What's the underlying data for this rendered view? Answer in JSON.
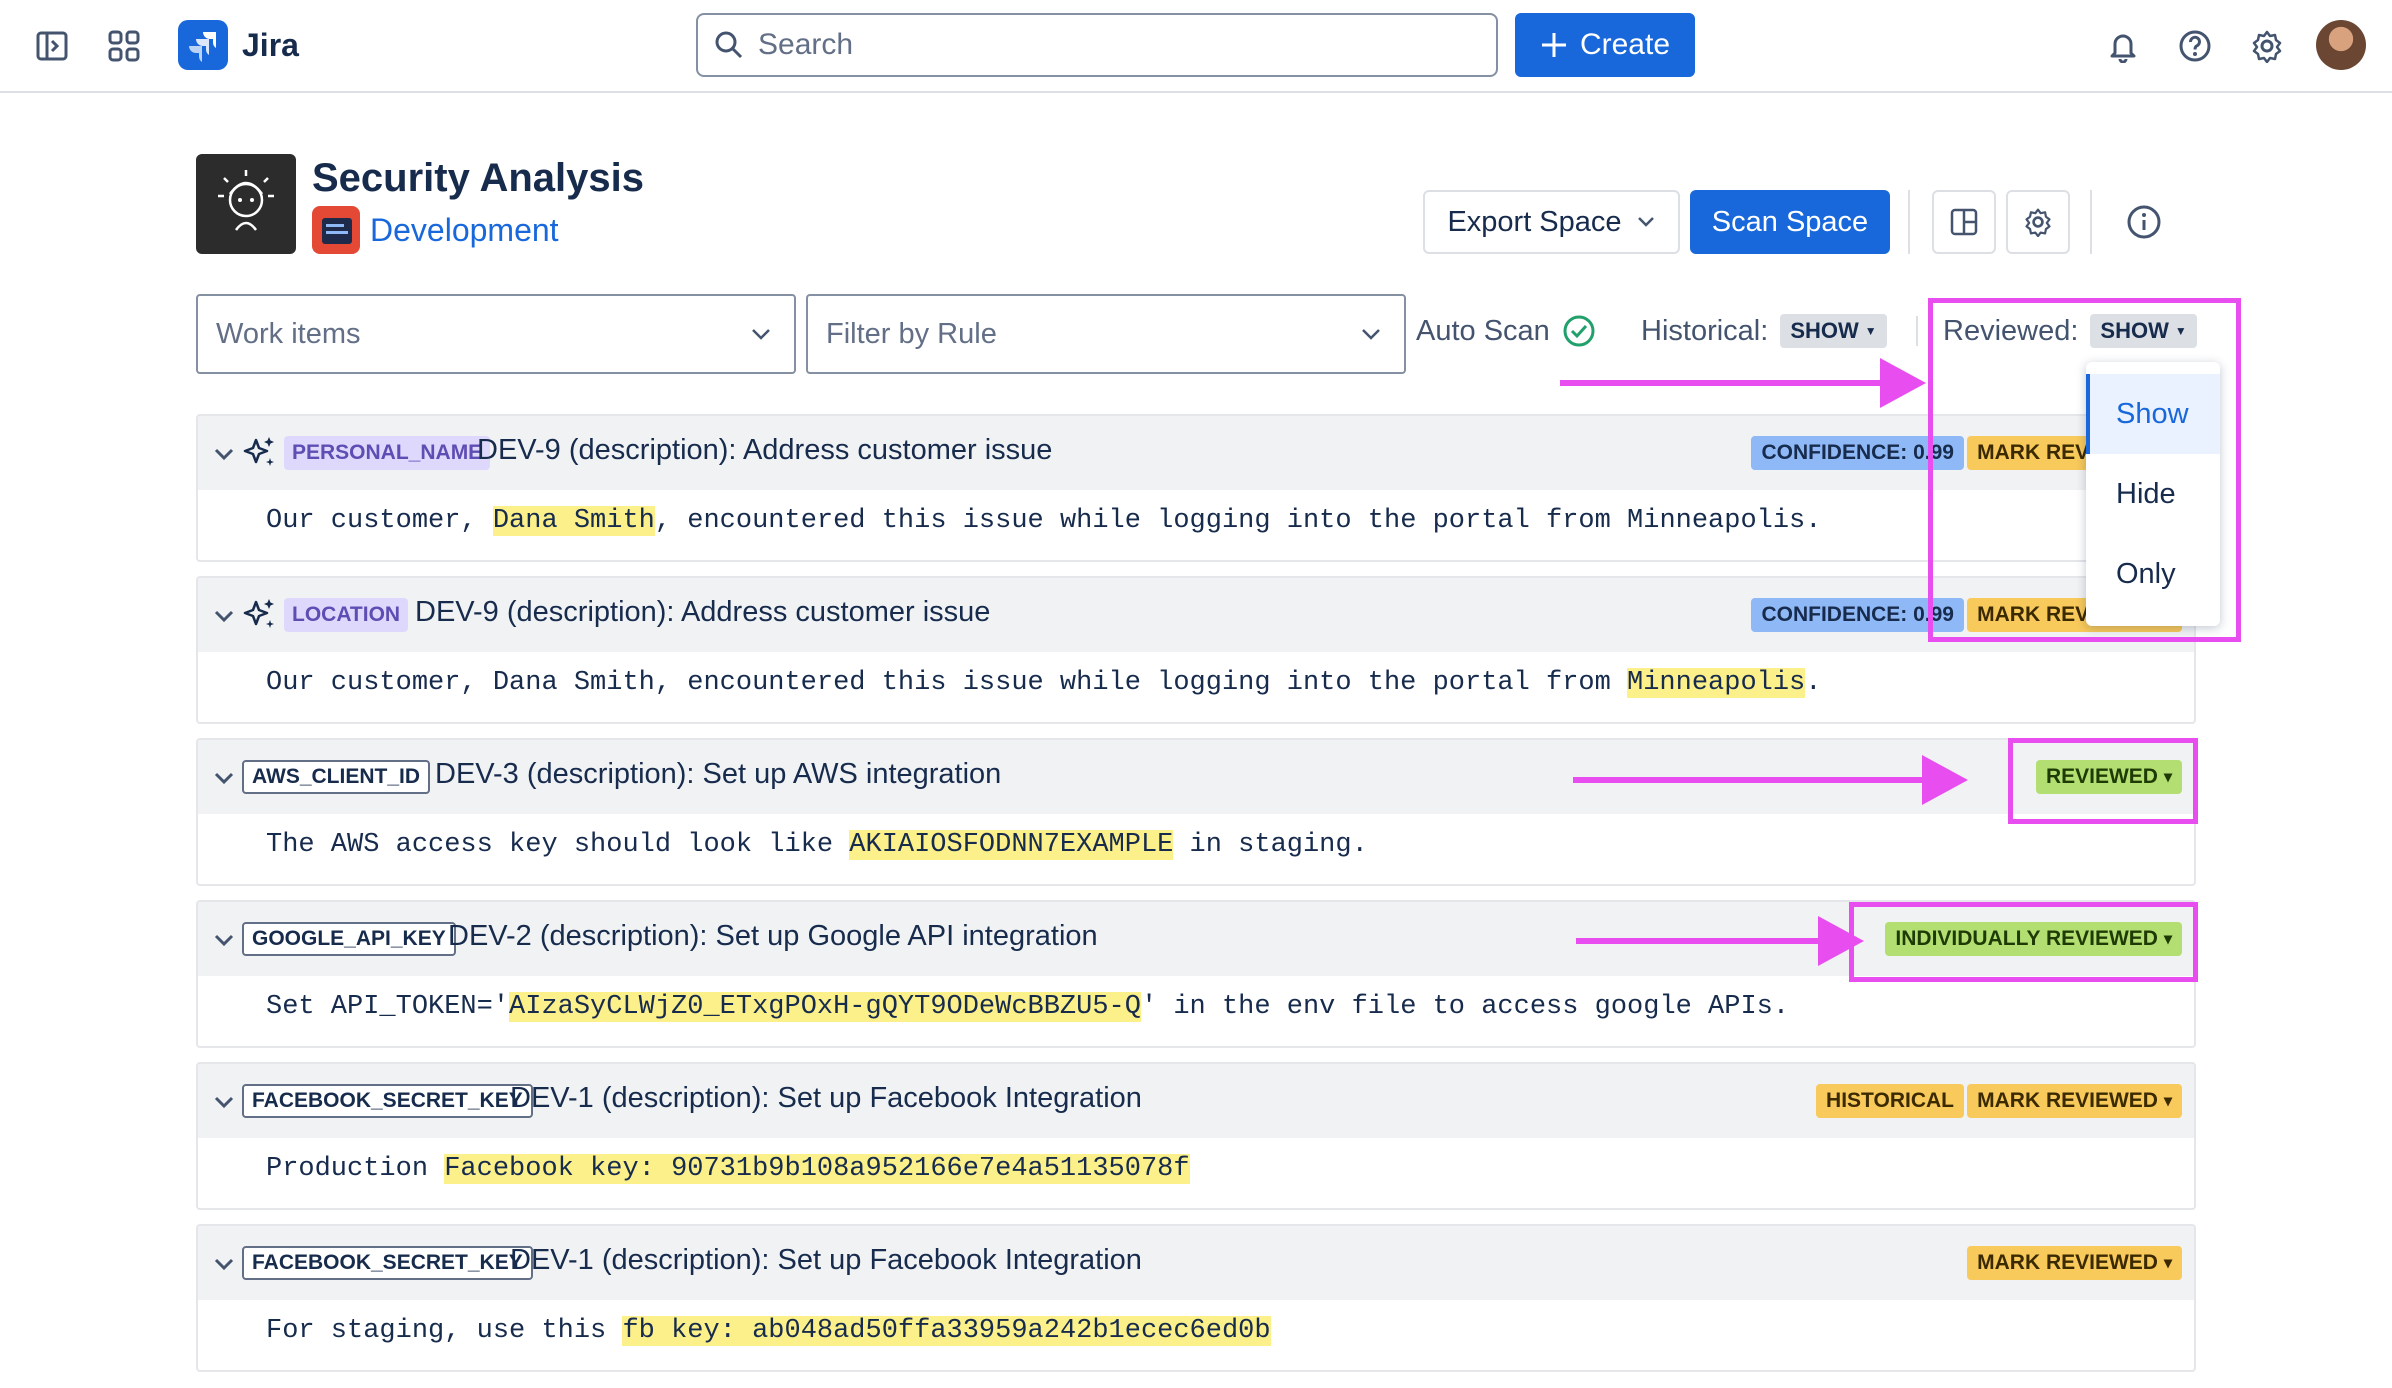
{
  "nav": {
    "app_name": "Jira",
    "search_placeholder": "Search",
    "create_label": "Create"
  },
  "space": {
    "title": "Security Analysis",
    "subtitle": "Development",
    "export_label": "Export Space",
    "scan_label": "Scan Space"
  },
  "filters": {
    "work_items_placeholder": "Work items",
    "rule_placeholder": "Filter by Rule",
    "auto_scan_label": "Auto Scan",
    "historical_label": "Historical:",
    "historical_value": "SHOW",
    "reviewed_label": "Reviewed:",
    "reviewed_value": "SHOW"
  },
  "reviewed_dropdown": {
    "options": [
      "Show",
      "Hide",
      "Only"
    ],
    "selected": "Show"
  },
  "findings": [
    {
      "rule": "PERSONAL_NAME",
      "ai": true,
      "title": "DEV-9 (description): Address customer issue",
      "badges": [
        "CONFIDENCE: 0.99",
        "MARK REVIEWED"
      ],
      "text_before": "Our customer, ",
      "highlight": "Dana Smith",
      "text_after": ", encountered this issue while logging into the portal from Minneapolis."
    },
    {
      "rule": "LOCATION",
      "ai": true,
      "title": "DEV-9 (description): Address customer issue",
      "badges": [
        "CONFIDENCE: 0.99",
        "MARK REVIEWED"
      ],
      "text_before": "Our customer, Dana Smith, encountered this issue while logging into the portal from ",
      "highlight": "Minneapolis",
      "text_after": "."
    },
    {
      "rule": "AWS_CLIENT_ID",
      "ai": false,
      "title": "DEV-3 (description): Set up AWS integration",
      "badges": [
        "REVIEWED"
      ],
      "text_before": "The AWS access key should look like ",
      "highlight": "AKIAIOSFODNN7EXAMPLE",
      "text_after": " in staging."
    },
    {
      "rule": "GOOGLE_API_KEY",
      "ai": false,
      "title": "DEV-2 (description): Set up Google API integration",
      "badges": [
        "INDIVIDUALLY REVIEWED"
      ],
      "text_before": "Set API_TOKEN='",
      "highlight": "AIzaSyCLWjZ0_ETxgPOxH-gQYT9ODeWcBBZU5-Q",
      "text_after": "' in the env file to access google APIs."
    },
    {
      "rule": "FACEBOOK_SECRET_KEY",
      "ai": false,
      "title": "DEV-1 (description): Set up Facebook Integration",
      "badges": [
        "HISTORICAL",
        "MARK REVIEWED"
      ],
      "text_before": "Production ",
      "highlight": "Facebook key: 90731b9b108a952166e7e4a51135078f",
      "text_after": ""
    },
    {
      "rule": "FACEBOOK_SECRET_KEY",
      "ai": false,
      "title": "DEV-1 (description): Set up Facebook Integration",
      "badges": [
        "MARK REVIEWED"
      ],
      "text_before": "For staging, use this ",
      "highlight": "fb key: ab048ad50ffa33959a242b1ecec6ed0b",
      "text_after": ""
    }
  ],
  "colors": {
    "primary": "#1868db",
    "annotation": "#e84df0",
    "highlight": "#fcf08a"
  }
}
